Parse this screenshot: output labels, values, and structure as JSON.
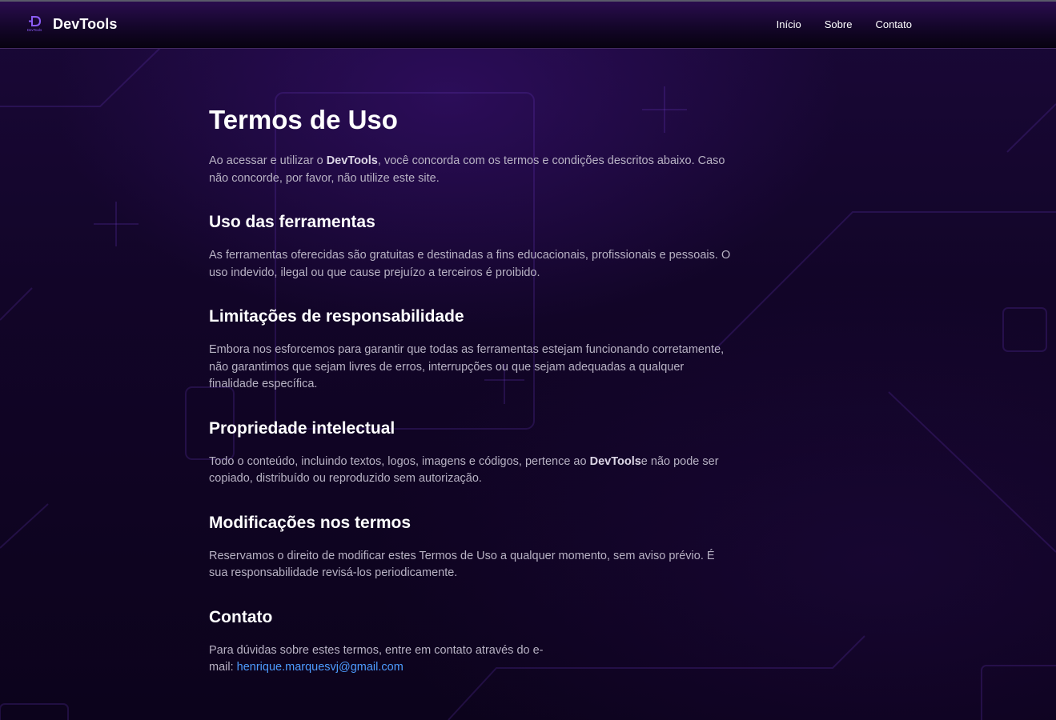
{
  "header": {
    "logo_mark_text": "DevTools",
    "brand": "DevTools",
    "nav": [
      "Início",
      "Sobre",
      "Contato"
    ]
  },
  "main": {
    "title": "Termos de Uso",
    "intro": {
      "before": "Ao acessar e utilizar o ",
      "brand": "DevTools",
      "after": ", você concorda com os termos e condições descritos abaixo. Caso não concorde, por favor, não utilize este site."
    },
    "sections": [
      {
        "heading": "Uso das ferramentas",
        "text": "As ferramentas oferecidas são gratuitas e destinadas a fins educacionais, profissionais e pessoais. O uso indevido, ilegal ou que cause prejuízo a terceiros é proibido."
      },
      {
        "heading": "Limitações de responsabilidade",
        "text": "Embora nos esforcemos para garantir que todas as ferramentas estejam funcionando corretamente, não garantimos que sejam livres de erros, interrupções ou que sejam adequadas a qualquer finalidade específica."
      },
      {
        "heading": "Propriedade intelectual",
        "text_before": "Todo o conteúdo, incluindo textos, logos, imagens e códigos, pertence ao ",
        "brand": "DevTools",
        "text_after": "e não pode ser copiado, distribuído ou reproduzido sem autorização."
      },
      {
        "heading": "Modificações nos termos",
        "text": "Reservamos o direito de modificar estes Termos de Uso a qualquer momento, sem aviso prévio. É sua responsabilidade revisá-los periodicamente."
      },
      {
        "heading": "Contato",
        "text": "Para dúvidas sobre estes termos, entre em contato através do e-mail: ",
        "email": "henrique.marquesvj@gmail.com"
      }
    ]
  },
  "colors": {
    "link": "#4d9bff",
    "accent": "#7c3aed"
  }
}
